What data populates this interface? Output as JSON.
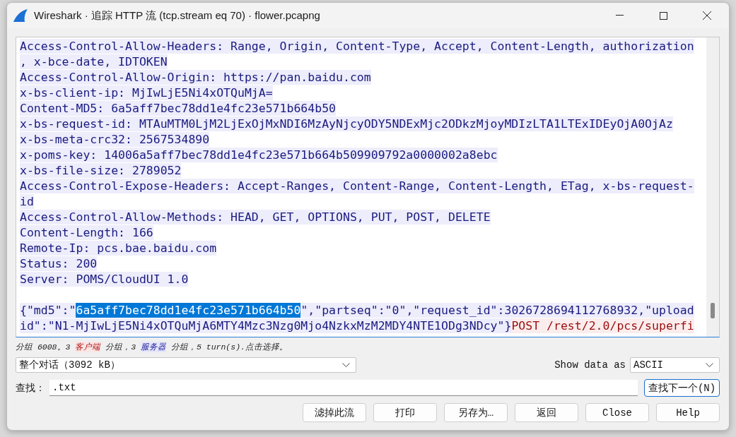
{
  "window": {
    "title": "Wireshark · 追踪 HTTP 流 (tcp.stream eq 70) · flower.pcapng"
  },
  "stream": {
    "lines": [
      {
        "kind": "text",
        "segments": [
          {
            "text": "Access-Control-Allow-Headers: Range, Origin, Content-Type, Accept, Content-Length, authorization",
            "kind": "server"
          }
        ]
      },
      {
        "kind": "text",
        "segments": [
          {
            "text": ", x-bce-date, IDTOKEN",
            "kind": "server"
          }
        ]
      },
      {
        "kind": "text",
        "segments": [
          {
            "text": "Access-Control-Allow-Origin: https://pan.baidu.com",
            "kind": "server"
          }
        ]
      },
      {
        "kind": "text",
        "segments": [
          {
            "text": "x-bs-client-ip: MjIwLjE5Ni4xOTQuMjA=",
            "kind": "server"
          }
        ]
      },
      {
        "kind": "text",
        "segments": [
          {
            "text": "Content-MD5: 6a5aff7bec78dd1e4fc23e571b664b50",
            "kind": "server"
          }
        ]
      },
      {
        "kind": "text",
        "segments": [
          {
            "text": "x-bs-request-id: MTAuMTM0LjM2LjExOjMxNDI6MzAyNjcyODY5NDExMjc2ODkzMjoyMDIzLTA1LTExIDEyOjA0OjAz",
            "kind": "server"
          }
        ]
      },
      {
        "kind": "text",
        "segments": [
          {
            "text": "x-bs-meta-crc32: 2567534890",
            "kind": "server"
          }
        ]
      },
      {
        "kind": "text",
        "segments": [
          {
            "text": "x-poms-key: 14006a5aff7bec78dd1e4fc23e571b664b509909792a0000002a8ebc",
            "kind": "server"
          }
        ]
      },
      {
        "kind": "text",
        "segments": [
          {
            "text": "x-bs-file-size: 2789052",
            "kind": "server"
          }
        ]
      },
      {
        "kind": "text",
        "segments": [
          {
            "text": "Access-Control-Expose-Headers: Accept-Ranges, Content-Range, Content-Length, ETag, x-bs-request-",
            "kind": "server"
          }
        ]
      },
      {
        "kind": "text",
        "segments": [
          {
            "text": "id",
            "kind": "server"
          }
        ]
      },
      {
        "kind": "text",
        "segments": [
          {
            "text": "Access-Control-Allow-Methods: HEAD, GET, OPTIONS, PUT, POST, DELETE",
            "kind": "server"
          }
        ]
      },
      {
        "kind": "text",
        "segments": [
          {
            "text": "Content-Length: 166",
            "kind": "server"
          }
        ]
      },
      {
        "kind": "text",
        "segments": [
          {
            "text": "Remote-Ip: pcs.bae.baidu.com",
            "kind": "server"
          }
        ]
      },
      {
        "kind": "text",
        "segments": [
          {
            "text": "Status: 200",
            "kind": "server"
          }
        ]
      },
      {
        "kind": "text",
        "segments": [
          {
            "text": "Server: POMS/CloudUI 1.0",
            "kind": "server"
          }
        ]
      },
      {
        "kind": "blank"
      },
      {
        "kind": "text",
        "segments": [
          {
            "text": "{\"md5\":\"",
            "kind": "server"
          },
          {
            "text": "6a5aff7bec78dd1e4fc23e571b664b50",
            "kind": "selection"
          },
          {
            "text": "\",\"partseq\":\"0\",\"request_id\":3026728694112768932,\"upload",
            "kind": "server"
          }
        ]
      },
      {
        "kind": "text",
        "segments": [
          {
            "text": "id\":\"N1-MjIwLjE5Ni4xOTQuMjA6MTY4Mzc3Nzg0Mjo4NzkxMzM2MDY4NTE1ODg3NDcy\"}",
            "kind": "server"
          },
          {
            "text": "POST /rest/2.0/pcs/superfi",
            "kind": "client"
          }
        ]
      }
    ]
  },
  "status": {
    "segments": [
      {
        "text": "分组 6008。3 ",
        "kind": "plain"
      },
      {
        "text": "客户端",
        "kind": "client"
      },
      {
        "text": " 分组，3 ",
        "kind": "plain"
      },
      {
        "text": "服务器",
        "kind": "server"
      },
      {
        "text": " 分组，5 turn(s).点击选择。",
        "kind": "plain"
      }
    ]
  },
  "conversation_select": {
    "value": "整个对话（3092 kB）"
  },
  "show_data_as": {
    "label": "Show data as",
    "value": "ASCII"
  },
  "find": {
    "label": "查找：",
    "value": ".txt",
    "button": "查找下一个(N)"
  },
  "buttons": [
    "滤掉此流",
    "打印",
    "另存为…",
    "返回",
    "Close",
    "Help"
  ]
}
